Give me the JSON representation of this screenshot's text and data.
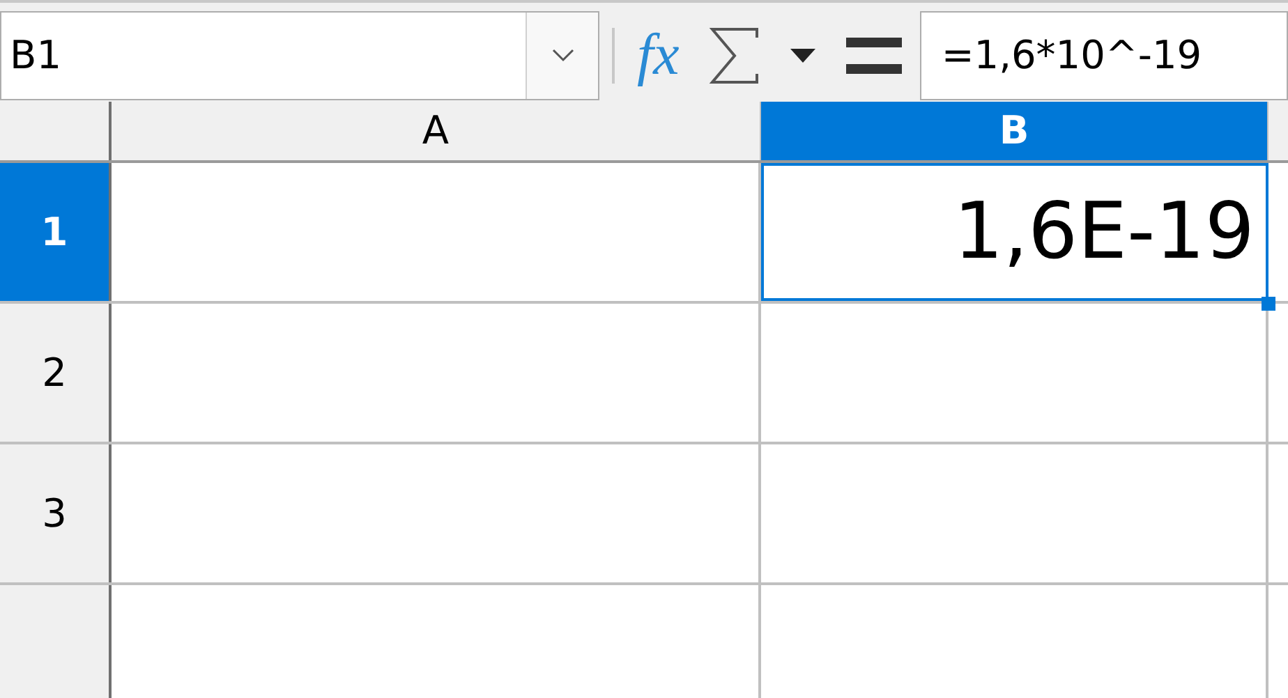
{
  "formula_bar": {
    "name_box": "B1",
    "function_button": "fx",
    "formula": "=1,6*10^-19"
  },
  "columns": [
    {
      "label": "A",
      "selected": false
    },
    {
      "label": "B",
      "selected": true
    }
  ],
  "rows": [
    {
      "label": "1",
      "selected": true,
      "cells": [
        {
          "selected": false
        },
        {
          "value": "1,6E-19",
          "selected": true
        }
      ]
    },
    {
      "label": "2",
      "selected": false,
      "cells": [
        {
          "selected": false
        },
        {
          "selected": false
        }
      ]
    },
    {
      "label": "3",
      "selected": false,
      "cells": [
        {
          "selected": false
        },
        {
          "selected": false
        }
      ]
    },
    {
      "selected": false,
      "cells": [
        {
          "selected": false
        },
        {
          "selected": false
        }
      ]
    }
  ]
}
